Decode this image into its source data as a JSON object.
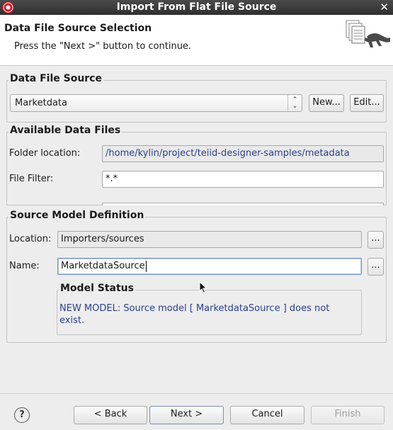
{
  "window": {
    "title": "Import From Flat File Source"
  },
  "header": {
    "title": "Data File Source Selection",
    "description": "Press the \"Next >\" button to continue."
  },
  "data_file_source": {
    "label": "Data File Source",
    "selected": "Marketdata",
    "new_button": "New...",
    "edit_button": "Edit..."
  },
  "available_files": {
    "label": "Available Data Files",
    "folder_label": "Folder location:",
    "folder_value": "/home/kylin/project/teiid-designer-samples/metadata",
    "filter_label": "File Filter:",
    "filter_value": "*.*"
  },
  "source_model": {
    "label": "Source Model Definition",
    "location_label": "Location:",
    "location_value": "Importers/sources",
    "location_browse": "...",
    "name_label": "Name:",
    "name_value": "MarketdataSource",
    "name_browse": "..."
  },
  "model_status": {
    "label": "Model Status",
    "message": "NEW MODEL: Source model [ MarketdataSource ] does not exist."
  },
  "footer": {
    "help": "?",
    "back": "< Back",
    "next": "Next >",
    "cancel": "Cancel",
    "finish": "Finish"
  },
  "icons": {
    "close": "close-icon",
    "app": "app-icon",
    "help": "help-icon",
    "combo_arrows": "up-down-arrows-icon"
  }
}
